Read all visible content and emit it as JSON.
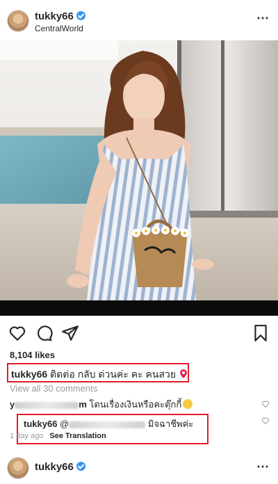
{
  "post": {
    "username": "tukky66",
    "location": "CentralWorld",
    "more_icon": "⋯",
    "likes": "8,104 likes",
    "caption_user": "tukky66",
    "caption_text": "ติดต่อ กลับ  ด่วนค่ะ คะ คนสวย",
    "view_all": "View all 30 comments"
  },
  "comments": {
    "first": {
      "user_partial": "y",
      "user_tail": "m",
      "text": "โดนเรื่องเงินหรือคะตุ๊กกี้"
    },
    "reply": {
      "user": "tukky66",
      "mention_start": "@",
      "text": "มิจฉาชีพค่ะ",
      "time": "1 day ago",
      "translate": "See Translation"
    }
  },
  "next_post": {
    "username": "tukky66",
    "more_icon": "⋯"
  },
  "colors": {
    "highlight": "#e31b2b",
    "verified": "#3897f0",
    "muted": "#999999"
  },
  "icons": [
    "heart-icon",
    "comment-icon",
    "share-icon",
    "bookmark-icon",
    "verified-icon",
    "more-icon",
    "location-pin-icon"
  ]
}
